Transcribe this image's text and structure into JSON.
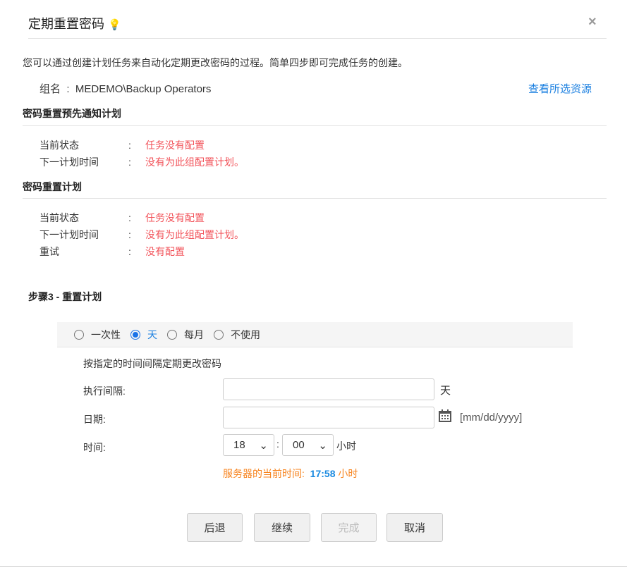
{
  "title": "定期重置密码",
  "description": "您可以通过创建计划任务来自动化定期更改密码的过程。简单四步即可完成任务的创建。",
  "group": {
    "label": "组名",
    "value": "MEDEMO\\Backup Operators",
    "link": "查看所选资源"
  },
  "notify": {
    "heading": "密码重置预先通知计划",
    "rows": [
      {
        "label": "当前状态",
        "value": "任务没有配置"
      },
      {
        "label": "下一计划时间",
        "value": "没有为此组配置计划。"
      }
    ]
  },
  "reset": {
    "heading": "密码重置计划",
    "rows": [
      {
        "label": "当前状态",
        "value": "任务没有配置"
      },
      {
        "label": "下一计划时间",
        "value": "没有为此组配置计划。"
      },
      {
        "label": "重试",
        "value": "没有配置"
      }
    ]
  },
  "colon": ":",
  "step": {
    "heading": "步骤3 - 重置计划",
    "options": [
      "一次性",
      "天",
      "每月",
      "不使用"
    ],
    "selected": "天",
    "desc": "按指定的时间间隔定期更改密码",
    "interval_label": "执行间隔:",
    "interval_value": "",
    "interval_unit": "天",
    "date_label": "日期:",
    "date_value": "",
    "date_format": "[mm/dd/yyyy]",
    "time_label": "时间:",
    "hour": "18",
    "minute": "00",
    "time_sep": ":",
    "time_unit": "小时",
    "server_time_label": "服务器的当前时间:",
    "server_time": "17:58",
    "server_time_unit": "小时"
  },
  "buttons": {
    "back": "后退",
    "continue": "继续",
    "finish": "完成",
    "cancel": "取消"
  }
}
